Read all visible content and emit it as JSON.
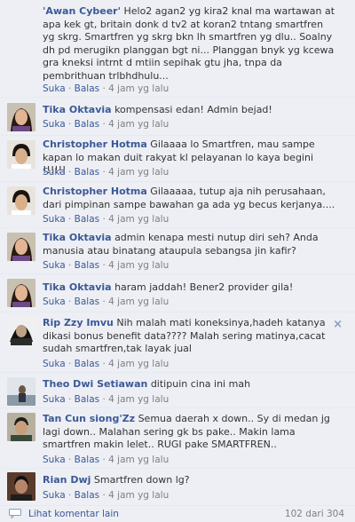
{
  "comments": [
    {
      "author": "'Awan Cybeer'",
      "text": "Helo2 agan2 yg kira2 knal ma wartawan at apa kek gt, britain donk d tv2 at koran2 tntang smartfren yg skrg. Smartfren yg skrg bkn lh smartfren yg dlu.. Soalny dh pd merugikn planggan bgt ni... Planggan bnyk yg kcewa gra kneksi intrnt d mtiin sepihak gtu jha, tnpa da pembrithuan trlbhdhulu...",
      "like": "Suka",
      "reply": "Balas",
      "time": "4 jam yg lalu"
    },
    {
      "author": "Tika Oktavia",
      "text": "kompensasi edan! Admin bejad!",
      "like": "Suka",
      "reply": "Balas",
      "time": "4 jam yg lalu"
    },
    {
      "author": "Christopher Hotma",
      "text": "Gilaaaa lo Smartfren, mau sampe kapan lo makan duit rakyat kl pelayanan lo kaya begini !!!!!!",
      "like": "Suka",
      "reply": "Balas",
      "time": "4 jam yg lalu"
    },
    {
      "author": "Christopher Hotma",
      "text": "Gilaaaaa, tutup aja nih perusahaan, dari pimpinan sampe bawahan ga ada yg becus kerjanya....",
      "like": "Suka",
      "reply": "Balas",
      "time": "4 jam yg lalu"
    },
    {
      "author": "Tika Oktavia",
      "text": "admin kenapa mesti nutup diri seh? Anda manusia atau binatang ataupula sebangsa jin kafir?",
      "like": "Suka",
      "reply": "Balas",
      "time": "4 jam yg lalu"
    },
    {
      "author": "Tika Oktavia",
      "text": "haram jaddah! Bener2 provider gila!",
      "like": "Suka",
      "reply": "Balas",
      "time": "4 jam yg lalu"
    },
    {
      "author": "Rip Zzy Imvu",
      "text": "Nih malah mati koneksinya,hadeh katanya dikasi bonus benefit data???? Malah sering matinya,cacat sudah smartfren,tak layak jual",
      "like": "Suka",
      "reply": "Balas",
      "time": "4 jam yg lalu"
    },
    {
      "author": "Theo Dwi Setiawan",
      "text": "ditipuin cina ini mah",
      "like": "Suka",
      "reply": "Balas",
      "time": "4 jam yg lalu"
    },
    {
      "author": "Tan Cun siong'Zz",
      "text": "Semua daerah x down.. Sy di medan jg lagi down.. Malahan sering gk bs pake.. Makin lama smartfren makin lelet.. RUGI pake SMARTFREN..",
      "like": "Suka",
      "reply": "Balas",
      "time": "4 jam yg lalu"
    },
    {
      "author": "Rian Dwj",
      "text": "Smartfren down lg?",
      "like": "Suka",
      "reply": "Balas",
      "time": "4 jam yg lalu"
    }
  ],
  "close_icon": "×",
  "footer": {
    "more": "Lihat komentar lain",
    "count": "102 dari 304"
  }
}
